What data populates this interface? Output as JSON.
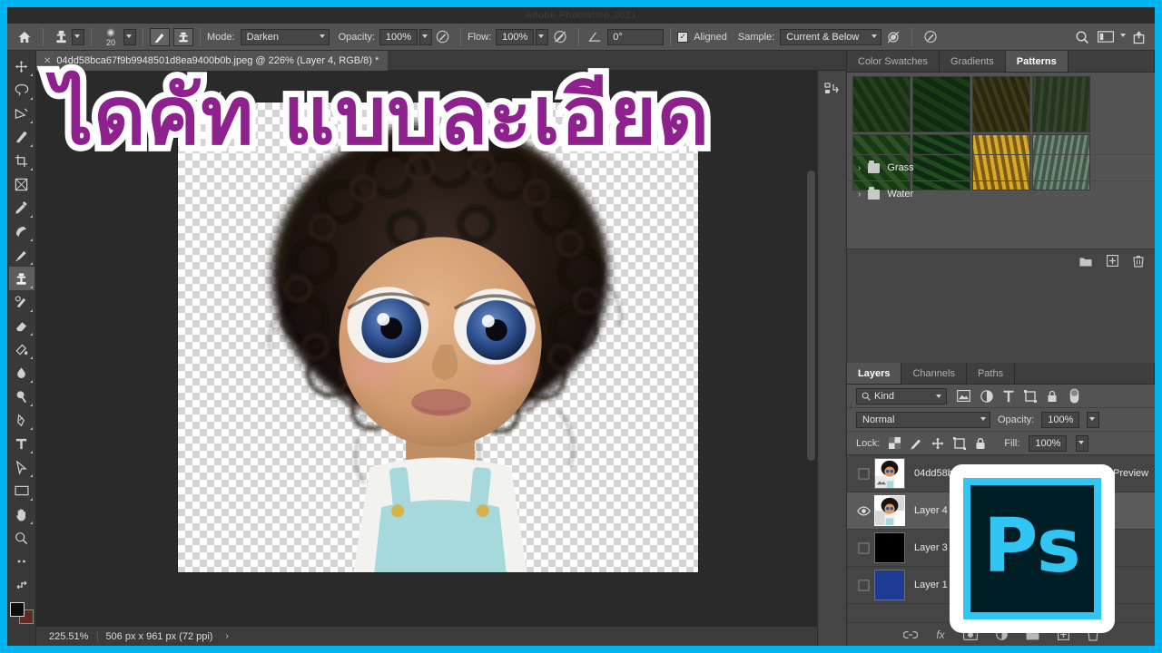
{
  "window": {
    "title": "Adobe Photoshop 2021",
    "accent_color": "#00b4f0"
  },
  "headline": {
    "text": "ไดคัท แบบละเอียด",
    "fill_color": "#8e218e",
    "stroke_color": "#ffffff"
  },
  "options_bar": {
    "home_icon": "home-icon",
    "tool_icon": "clone-stamp-icon",
    "brush_size": "20",
    "brush_panel_icon": "brush-settings-icon",
    "clone_source_icon": "clone-source-icon",
    "mode_label": "Mode:",
    "mode_value": "Darken",
    "opacity_label": "Opacity:",
    "opacity_value": "100%",
    "pressure_opacity_icon": "pressure-opacity-icon",
    "flow_label": "Flow:",
    "flow_value": "100%",
    "airbrush_icon": "airbrush-icon",
    "angle_icon": "angle-icon",
    "angle_value": "0°",
    "aligned_label": "Aligned",
    "aligned_checked": "✓",
    "sample_label": "Sample:",
    "sample_value": "Current & Below",
    "ignore_adjustment_icon": "ignore-adjustment-layers-icon",
    "pressure_size_icon": "pressure-size-icon",
    "search_icon": "search-icon",
    "workspace_icon": "workspace-layout-icon",
    "share_icon": "share-icon"
  },
  "document_tab": {
    "close_icon": "close-icon",
    "title": "04dd58bca67f9b9948501d8ea9400b0b.jpeg @ 226% (Layer 4, RGB/8) *",
    "collapse_icon": "collapse-panels-icon"
  },
  "toolbar": {
    "tools": [
      {
        "name": "move-tool",
        "glyph": "move",
        "selected": false,
        "has_flyout": true
      },
      {
        "name": "lasso-tool",
        "glyph": "lasso",
        "selected": false,
        "has_flyout": true
      },
      {
        "name": "magic-wand-tool",
        "glyph": "wand",
        "selected": false,
        "has_flyout": true
      },
      {
        "name": "spot-healing-brush-tool",
        "glyph": "heal",
        "selected": false,
        "has_flyout": true
      },
      {
        "name": "crop-tool",
        "glyph": "crop",
        "selected": false,
        "has_flyout": true
      },
      {
        "name": "frame-tool",
        "glyph": "frame",
        "selected": false,
        "has_flyout": false
      },
      {
        "name": "eyedropper-tool",
        "glyph": "eyedropper",
        "selected": false,
        "has_flyout": true
      },
      {
        "name": "patch-tool",
        "glyph": "patch",
        "selected": false,
        "has_flyout": true
      },
      {
        "name": "brush-tool",
        "glyph": "brush",
        "selected": false,
        "has_flyout": true
      },
      {
        "name": "clone-stamp-tool",
        "glyph": "stamp",
        "selected": true,
        "has_flyout": true
      },
      {
        "name": "history-brush-tool",
        "glyph": "historybrush",
        "selected": false,
        "has_flyout": true
      },
      {
        "name": "eraser-tool",
        "glyph": "eraser",
        "selected": false,
        "has_flyout": true
      },
      {
        "name": "gradient-tool",
        "glyph": "bucket",
        "selected": false,
        "has_flyout": true
      },
      {
        "name": "blur-tool",
        "glyph": "blur",
        "selected": false,
        "has_flyout": true
      },
      {
        "name": "dodge-tool",
        "glyph": "dodge",
        "selected": false,
        "has_flyout": true
      },
      {
        "name": "pen-tool",
        "glyph": "pen",
        "selected": false,
        "has_flyout": true
      },
      {
        "name": "type-tool",
        "glyph": "type",
        "selected": false,
        "has_flyout": true
      },
      {
        "name": "path-selection-tool",
        "glyph": "pathselect",
        "selected": false,
        "has_flyout": true
      },
      {
        "name": "rectangle-tool",
        "glyph": "rect",
        "selected": false,
        "has_flyout": true
      },
      {
        "name": "hand-tool",
        "glyph": "hand",
        "selected": false,
        "has_flyout": true
      },
      {
        "name": "zoom-tool",
        "glyph": "zoom",
        "selected": false,
        "has_flyout": false
      },
      {
        "name": "edit-toolbar-tool",
        "glyph": "dots",
        "selected": false,
        "has_flyout": false
      },
      {
        "name": "swap-colors-tool",
        "glyph": "swap",
        "selected": false,
        "has_flyout": false
      }
    ],
    "foreground_color": "#0b0b0b",
    "background_color": "#5e2a24"
  },
  "patterns_panel": {
    "tabs": [
      {
        "label": "Color Swatches",
        "active": false
      },
      {
        "label": "Gradients",
        "active": false
      },
      {
        "label": "Patterns",
        "active": true
      }
    ],
    "swatch_rows": [
      [
        "#2a3d22",
        "#1d3318",
        "#3c3a1c",
        "#2d3a2c"
      ],
      [
        "#223a1c",
        "#16301a",
        "#b68a1e",
        "#55705b"
      ]
    ],
    "groups": [
      {
        "label": "Grass",
        "icon": "folder-icon",
        "chevron": "›"
      },
      {
        "label": "Water",
        "icon": "folder-icon",
        "chevron": "›"
      }
    ],
    "footer_icons": [
      "new-group-icon",
      "new-pattern-icon",
      "delete-icon"
    ]
  },
  "layers_panel": {
    "tabs": [
      {
        "label": "Layers",
        "active": true
      },
      {
        "label": "Channels",
        "active": false
      },
      {
        "label": "Paths",
        "active": false
      }
    ],
    "filter": {
      "kind_label": "Kind",
      "search_icon": "search-icon",
      "filter_icons": [
        "pixel-layer-filter-icon",
        "adjustment-layer-filter-icon",
        "type-layer-filter-icon",
        "shape-layer-filter-icon",
        "smart-object-filter-icon"
      ],
      "toggle_icon": "filter-toggle-icon"
    },
    "blend_mode": "Normal",
    "opacity_label": "Opacity:",
    "opacity_value": "100%",
    "lock_label": "Lock:",
    "lock_icons": [
      "lock-transparency-icon",
      "lock-image-icon",
      "lock-position-icon",
      "lock-artboard-icon",
      "lock-all-icon"
    ],
    "fill_label": "Fill:",
    "fill_value": "100%",
    "layers": [
      {
        "name": "04dd58bca67f9b9948501d8ea9400b0b.jpeg Preview",
        "visible": false,
        "selected": false,
        "thumb": "doll-photo",
        "has_mask": true
      },
      {
        "name": "Layer 4",
        "visible": true,
        "selected": true,
        "thumb": "doll-cutout",
        "has_mask": false
      },
      {
        "name": "Layer 3",
        "visible": false,
        "selected": false,
        "thumb": "black-fill",
        "has_mask": false
      },
      {
        "name": "Layer 1",
        "visible": false,
        "selected": false,
        "thumb": "blue-fill",
        "has_mask": false
      }
    ],
    "footer_icons": [
      "link-layers-icon",
      "add-layer-style-icon",
      "add-layer-mask-icon",
      "new-adjustment-layer-icon",
      "new-group-icon",
      "new-layer-icon",
      "delete-layer-icon"
    ]
  },
  "panel_rail": {
    "icons": [
      "history-actions-icon"
    ]
  },
  "status_bar": {
    "zoom": "225.51%",
    "dimensions": "506 px x 961 px (72 ppi)",
    "arrow": "›"
  },
  "ps_badge": {
    "letters": "Ps",
    "frame_color": "#ffffff",
    "border_color": "#31c5f4",
    "fill_color": "#001e26"
  }
}
